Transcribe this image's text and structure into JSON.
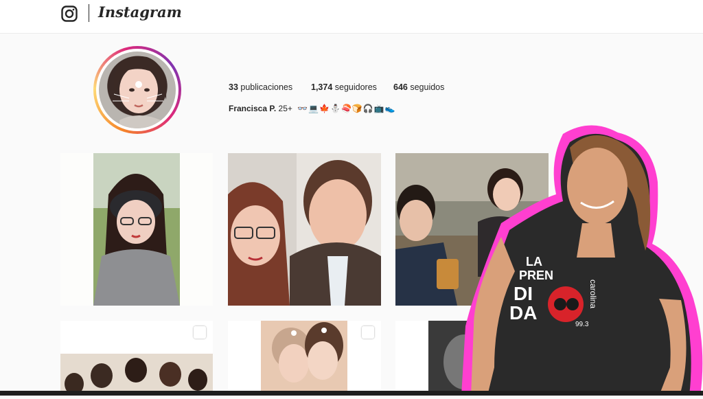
{
  "header": {
    "brand": "Instagram",
    "logo_icon": "instagram-camera-icon"
  },
  "profile": {
    "stats": {
      "posts_count": "33",
      "posts_label": "publicaciones",
      "followers_count": "1,374",
      "followers_label": "seguidores",
      "following_count": "646",
      "following_label": "seguidos"
    },
    "name": "Francisca P.",
    "bio_text": "25+",
    "bio_emojis": "👓💻🍁⛄🍣🍞🎧📺👟"
  },
  "posts_icon": "multiple-photos-icon",
  "overlay": {
    "shirt_brand_line1": "LA",
    "shirt_brand_line2": "PREN",
    "shirt_brand_line3": "DI",
    "shirt_brand_line4": "DA",
    "shirt_station": "carolina",
    "shirt_freq": "99.3"
  },
  "colors": {
    "accent_ring_start": "#f58529",
    "accent_ring_end": "#8134af",
    "overlay_outline": "#ff3fd0"
  }
}
